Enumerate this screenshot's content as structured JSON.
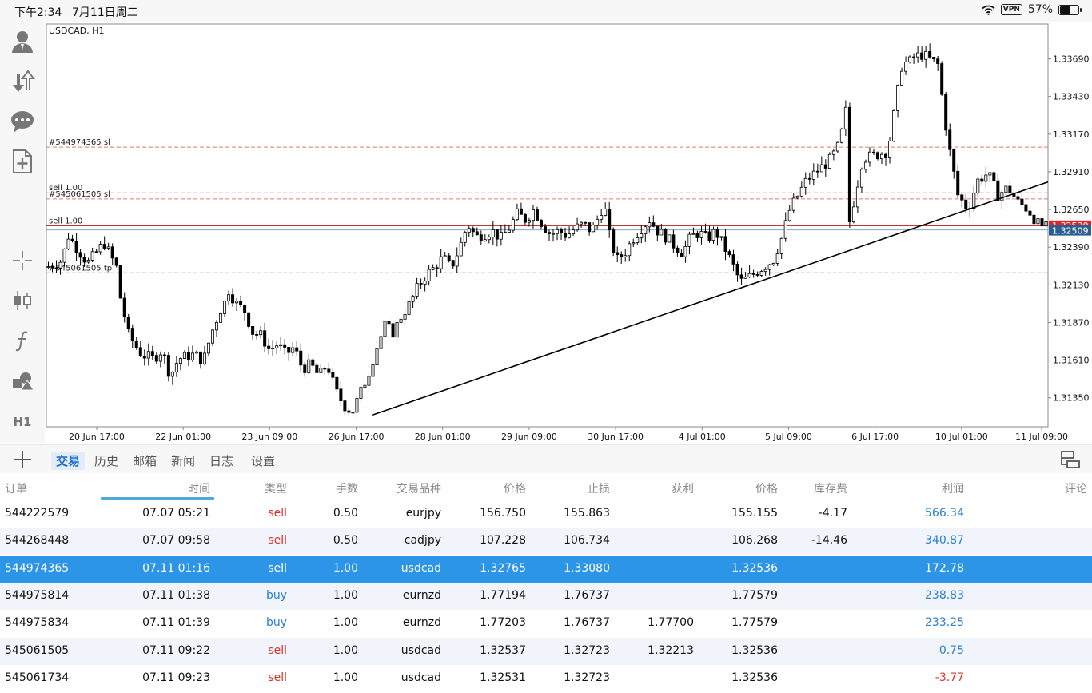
{
  "status": {
    "time": "下午2:34",
    "date": "7月11日周二",
    "vpn": "VPN",
    "battery": "57%",
    "battery_level": 0.57
  },
  "left_toolbar": [
    "account-icon",
    "trade-arrows-icon",
    "chat-icon",
    "new-order-icon",
    "crosshair-icon",
    "candlestick-icon",
    "indicator-f-icon",
    "objects-icon",
    "timeframe-h1"
  ],
  "timeframe_label": "H1",
  "chart_data": {
    "type": "candlestick",
    "symbol_label": "USDCAD, H1",
    "y_ticks": [
      "1.33690",
      "1.33430",
      "1.33170",
      "1.32910",
      "1.32650",
      "1.32390",
      "1.32130",
      "1.31870",
      "1.31610",
      "1.31350"
    ],
    "y_tick_values": [
      1.3369,
      1.3343,
      1.3317,
      1.3291,
      1.3265,
      1.3239,
      1.3213,
      1.3187,
      1.3161,
      1.3135
    ],
    "ylim": [
      1.3115,
      1.3393
    ],
    "x_ticks": [
      "20 Jun 17:00",
      "22 Jun 01:00",
      "23 Jun 09:00",
      "26 Jun 17:00",
      "28 Jun 01:00",
      "29 Jun 09:00",
      "30 Jun 17:00",
      "4 Jul 01:00",
      "5 Jul 09:00",
      "6 Jul 17:00",
      "10 Jul 01:00",
      "11 Jul 09:00"
    ],
    "current_price": "1.32509",
    "ask_price": "1.32530",
    "price_path": [
      [
        0,
        1.3225
      ],
      [
        0.02,
        1.323
      ],
      [
        0.025,
        1.3248
      ],
      [
        0.05,
        1.3228
      ],
      [
        0.07,
        1.3242
      ],
      [
        0.085,
        1.3225
      ],
      [
        0.09,
        1.3203
      ],
      [
        0.1,
        1.3178
      ],
      [
        0.115,
        1.3165
      ],
      [
        0.13,
        1.3162
      ],
      [
        0.14,
        1.3168
      ],
      [
        0.15,
        1.315
      ],
      [
        0.16,
        1.3162
      ],
      [
        0.18,
        1.3165
      ],
      [
        0.19,
        1.316
      ],
      [
        0.2,
        1.318
      ],
      [
        0.21,
        1.3195
      ],
      [
        0.22,
        1.3205
      ],
      [
        0.215,
        1.3215
      ],
      [
        0.23,
        1.32
      ],
      [
        0.24,
        1.3195
      ],
      [
        0.25,
        1.318
      ],
      [
        0.26,
        1.3178
      ],
      [
        0.27,
        1.3168
      ],
      [
        0.28,
        1.3172
      ],
      [
        0.29,
        1.3165
      ],
      [
        0.3,
        1.317
      ],
      [
        0.31,
        1.3155
      ],
      [
        0.32,
        1.3158
      ],
      [
        0.33,
        1.315
      ],
      [
        0.34,
        1.3158
      ],
      [
        0.35,
        1.314
      ],
      [
        0.36,
        1.313
      ],
      [
        0.37,
        1.3125
      ],
      [
        0.38,
        1.3138
      ],
      [
        0.39,
        1.3152
      ],
      [
        0.4,
        1.317
      ],
      [
        0.41,
        1.3185
      ],
      [
        0.42,
        1.318
      ],
      [
        0.43,
        1.3192
      ],
      [
        0.44,
        1.32
      ],
      [
        0.45,
        1.3212
      ],
      [
        0.46,
        1.322
      ],
      [
        0.47,
        1.3225
      ],
      [
        0.48,
        1.3232
      ],
      [
        0.49,
        1.3225
      ],
      [
        0.5,
        1.3238
      ],
      [
        0.51,
        1.3255
      ],
      [
        0.52,
        1.3246
      ],
      [
        0.53,
        1.3248
      ],
      [
        0.54,
        1.325
      ],
      [
        0.55,
        1.3245
      ],
      [
        0.56,
        1.3252
      ],
      [
        0.57,
        1.3262
      ],
      [
        0.58,
        1.3258
      ],
      [
        0.59,
        1.3265
      ],
      [
        0.6,
        1.3255
      ],
      [
        0.61,
        1.3248
      ],
      [
        0.62,
        1.325
      ],
      [
        0.63,
        1.3247
      ],
      [
        0.64,
        1.3252
      ],
      [
        0.65,
        1.3255
      ],
      [
        0.66,
        1.325
      ],
      [
        0.67,
        1.3262
      ],
      [
        0.675,
        1.327
      ],
      [
        0.68,
        1.325
      ],
      [
        0.69,
        1.323
      ],
      [
        0.7,
        1.3235
      ],
      [
        0.71,
        1.3245
      ],
      [
        0.72,
        1.3252
      ],
      [
        0.73,
        1.3258
      ],
      [
        0.74,
        1.325
      ],
      [
        0.75,
        1.3246
      ],
      [
        0.76,
        1.324
      ],
      [
        0.77,
        1.3235
      ],
      [
        0.78,
        1.3246
      ],
      [
        0.79,
        1.3249
      ],
      [
        0.8,
        1.3245
      ],
      [
        0.81,
        1.325
      ],
      [
        0.82,
        1.324
      ],
      [
        0.83,
        1.3228
      ],
      [
        0.84,
        1.3215
      ],
      [
        0.85,
        1.3218
      ],
      [
        0.86,
        1.3222
      ],
      [
        0.87,
        1.3226
      ],
      [
        0.88,
        1.323
      ],
      [
        0.89,
        1.3245
      ],
      [
        0.9,
        1.3265
      ],
      [
        0.91,
        1.3275
      ],
      [
        0.92,
        1.3285
      ],
      [
        0.93,
        1.329
      ],
      [
        0.94,
        1.3295
      ],
      [
        0.95,
        1.33
      ],
      [
        0.96,
        1.331
      ],
      [
        0.97,
        1.334
      ],
      [
        0.98,
        1.3365
      ],
      [
        0.99,
        1.337
      ],
      [
        1.0,
        1.337
      ]
    ],
    "price_path_note": "",
    "trendline": [
      [
        0.325,
        1.3123
      ],
      [
        1.0,
        1.3284
      ]
    ],
    "levels": [
      {
        "label": "#544974365 sl",
        "value": 1.3308,
        "color": "#e07b6a",
        "style": "dashed"
      },
      {
        "label": "sell 1.00",
        "value": 1.32765,
        "color": "#e07b6a",
        "style": "dashed"
      },
      {
        "label": "#545061505 sl",
        "value": 1.32723,
        "color": "#e07b6a",
        "style": "dashed"
      },
      {
        "label": "sell 1.00",
        "value": 1.32537,
        "color": "#c0392b",
        "style": "solid"
      },
      {
        "label": "#545061505 tp",
        "value": 1.32213,
        "color": "#e07b6a",
        "style": "dashed"
      }
    ],
    "bid_line": 1.32509
  },
  "tabs": {
    "trade": "交易",
    "history": "历史",
    "mailbox": "邮箱",
    "news": "新闻",
    "journal": "日志",
    "settings": "设置"
  },
  "columns": {
    "order": "订单",
    "time": "时间",
    "type": "类型",
    "volume": "手数",
    "symbol": "交易品种",
    "price_open": "价格",
    "sl": "止损",
    "tp": "获利",
    "price_cur": "价格",
    "swap": "库存费",
    "profit": "利润",
    "comment": "评论"
  },
  "rows": [
    {
      "order": "544222579",
      "time": "07.07 05:21",
      "type": "sell",
      "volume": "0.50",
      "symbol": "eurjpy",
      "price_open": "156.750",
      "sl": "155.863",
      "tp": "",
      "price_cur": "155.155",
      "swap": "-4.17",
      "profit": "566.34"
    },
    {
      "order": "544268448",
      "time": "07.07 09:58",
      "type": "sell",
      "volume": "0.50",
      "symbol": "cadjpy",
      "price_open": "107.228",
      "sl": "106.734",
      "tp": "",
      "price_cur": "106.268",
      "swap": "-14.46",
      "profit": "340.87"
    },
    {
      "order": "544974365",
      "time": "07.11 01:16",
      "type": "sell",
      "volume": "1.00",
      "symbol": "usdcad",
      "price_open": "1.32765",
      "sl": "1.33080",
      "tp": "",
      "price_cur": "1.32536",
      "swap": "",
      "profit": "172.78"
    },
    {
      "order": "544975814",
      "time": "07.11 01:38",
      "type": "buy",
      "volume": "1.00",
      "symbol": "eurnzd",
      "price_open": "1.77194",
      "sl": "1.76737",
      "tp": "",
      "price_cur": "1.77579",
      "swap": "",
      "profit": "238.83"
    },
    {
      "order": "544975834",
      "time": "07.11 01:39",
      "type": "buy",
      "volume": "1.00",
      "symbol": "eurnzd",
      "price_open": "1.77203",
      "sl": "1.76737",
      "tp": "1.77700",
      "price_cur": "1.77579",
      "swap": "",
      "profit": "233.25"
    },
    {
      "order": "545061505",
      "time": "07.11 09:22",
      "type": "sell",
      "volume": "1.00",
      "symbol": "usdcad",
      "price_open": "1.32537",
      "sl": "1.32723",
      "tp": "1.32213",
      "price_cur": "1.32536",
      "swap": "",
      "profit": "0.75"
    },
    {
      "order": "545061734",
      "time": "07.11 09:23",
      "type": "sell",
      "volume": "1.00",
      "symbol": "usdcad",
      "price_open": "1.32531",
      "sl": "1.32723",
      "tp": "",
      "price_cur": "1.32536",
      "swap": "",
      "profit": "-3.77"
    }
  ],
  "selected_row": 2
}
